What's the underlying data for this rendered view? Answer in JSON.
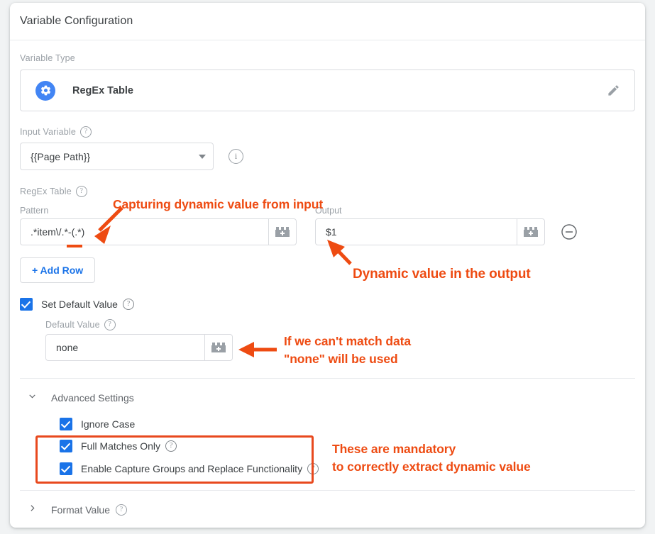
{
  "card": {
    "title": "Variable Configuration"
  },
  "variable_type": {
    "label": "Variable Type",
    "name": "RegEx Table",
    "icon": "gear-icon",
    "edit_icon": "pencil-icon"
  },
  "input_variable": {
    "label": "Input Variable",
    "help": "?",
    "value": "{{Page Path}}",
    "info_icon": "info-icon"
  },
  "regex_table": {
    "label": "RegEx Table",
    "help": "?",
    "columns": {
      "pattern": "Pattern",
      "output": "Output"
    },
    "rows": [
      {
        "pattern": ".*item\\/.*-(.*)",
        "output": "$1"
      }
    ],
    "variable_picker_icon": "brick-plus-icon",
    "remove_row_icon": "minus-circle-icon",
    "add_row_label": "+ Add Row"
  },
  "default_value": {
    "checkbox_label": "Set Default Value",
    "checkbox_checked": true,
    "field_label": "Default Value",
    "value": "none"
  },
  "advanced_settings": {
    "title": "Advanced Settings",
    "expanded": true,
    "chevron": "⌄",
    "options": [
      {
        "label": "Ignore Case",
        "checked": true,
        "has_help": false
      },
      {
        "label": "Full Matches Only",
        "checked": true,
        "has_help": true
      },
      {
        "label": "Enable Capture Groups and Replace Functionality",
        "checked": true,
        "has_help": true
      }
    ]
  },
  "format_value": {
    "title": "Format Value",
    "expanded": false,
    "chevron": "›"
  },
  "annotations": {
    "accent_color": "#ee4b12",
    "highlight_color": "#e8491e",
    "capture_note": "Capturing dynamic value from input",
    "output_note": "Dynamic value in the output",
    "default_note": "If we can't match data\n\"none\" will be used",
    "mandatory_note": "These are mandatory\nto correctly extract dynamic value"
  }
}
